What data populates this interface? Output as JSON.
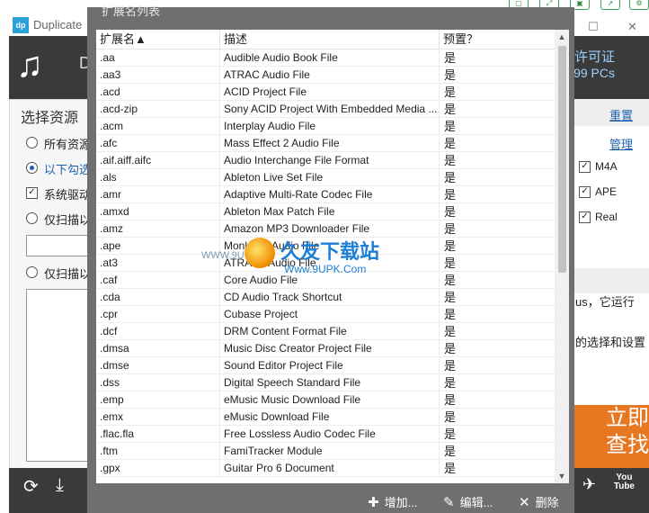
{
  "background": {
    "app_title": "Duplicate",
    "app_icon": "app-logo-icon",
    "header_letter": "D",
    "license_line1": "许可证",
    "license_line2": "99 PCs",
    "left_panel": {
      "title": "选择资源",
      "options": [
        "所有资源",
        "以下勾选",
        "系统驱动",
        "仅扫描以",
        "仅扫描以"
      ]
    },
    "right_panel": {
      "reset_link": "重置",
      "manage_link": "管理",
      "checks": [
        "M4A",
        "APE",
        "Real"
      ],
      "text1": "us，它运行",
      "text2": "的选择和设置",
      "search_button": [
        "立即",
        "查找"
      ]
    },
    "bottom_icons": [
      "refresh-icon",
      "download-icon",
      "twitter-icon",
      "youtube-icon"
    ],
    "youtube_label": [
      "You",
      "Tube"
    ]
  },
  "dialog": {
    "title": "扩展名列表",
    "columns": {
      "ext": "扩展名▲",
      "desc": "描述",
      "preset": "预置？"
    },
    "rows": [
      {
        "ext": ".aa",
        "desc": "Audible Audio Book File",
        "preset": "是"
      },
      {
        "ext": ".aa3",
        "desc": "ATRAC Audio File",
        "preset": "是"
      },
      {
        "ext": ".acd",
        "desc": "ACID Project File",
        "preset": "是"
      },
      {
        "ext": ".acd-zip",
        "desc": "Sony ACID Project With Embedded Media ...",
        "preset": "是"
      },
      {
        "ext": ".acm",
        "desc": "Interplay Audio File",
        "preset": "是"
      },
      {
        "ext": ".afc",
        "desc": "Mass Effect 2 Audio File",
        "preset": "是"
      },
      {
        "ext": ".aif.aiff.aifc",
        "desc": "Audio Interchange File Format",
        "preset": "是"
      },
      {
        "ext": ".als",
        "desc": "Ableton Live Set File",
        "preset": "是"
      },
      {
        "ext": ".amr",
        "desc": "Adaptive Multi-Rate Codec File",
        "preset": "是"
      },
      {
        "ext": ".amxd",
        "desc": "Ableton Max Patch File",
        "preset": "是"
      },
      {
        "ext": ".amz",
        "desc": "Amazon MP3 Downloader File",
        "preset": "是"
      },
      {
        "ext": ".ape",
        "desc": "Monkey's Audio File",
        "preset": "是"
      },
      {
        "ext": ".at3",
        "desc": "ATRAC3 Audio File",
        "preset": "是"
      },
      {
        "ext": ".caf",
        "desc": "Core Audio File",
        "preset": "是"
      },
      {
        "ext": ".cda",
        "desc": "CD Audio Track Shortcut",
        "preset": "是"
      },
      {
        "ext": ".cpr",
        "desc": "Cubase Project",
        "preset": "是"
      },
      {
        "ext": ".dcf",
        "desc": "DRM Content Format File",
        "preset": "是"
      },
      {
        "ext": ".dmsa",
        "desc": "Music Disc Creator Project File",
        "preset": "是"
      },
      {
        "ext": ".dmse",
        "desc": "Sound Editor Project File",
        "preset": "是"
      },
      {
        "ext": ".dss",
        "desc": "Digital Speech Standard File",
        "preset": "是"
      },
      {
        "ext": ".emp",
        "desc": "eMusic Music Download File",
        "preset": "是"
      },
      {
        "ext": ".emx",
        "desc": "eMusic Download File",
        "preset": "是"
      },
      {
        "ext": ".flac.fla",
        "desc": "Free Lossless Audio Codec File",
        "preset": "是"
      },
      {
        "ext": ".ftm",
        "desc": "FamiTracker Module",
        "preset": "是"
      },
      {
        "ext": ".gpx",
        "desc": "Guitar Pro 6 Document",
        "preset": "是"
      }
    ],
    "footer": {
      "add": "增加...",
      "edit": "编辑...",
      "delete": "删除"
    }
  },
  "watermark": {
    "brand": "久友下载站",
    "url": "Www.9UPK.Com",
    "side": "WWW.9U"
  },
  "colors": {
    "header_dark": "#3a3a3a",
    "accent_blue": "#1a62b0",
    "search_orange": "#e87722",
    "dialog_frame": "#6f6f6f"
  }
}
